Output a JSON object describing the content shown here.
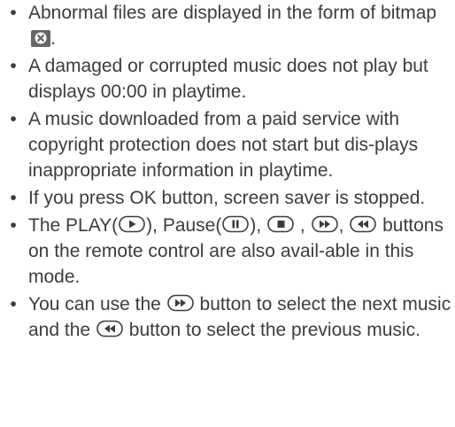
{
  "bullets": [
    {
      "text_before": "Abnormal files are displayed in the form of bitmap",
      "text_after": "."
    },
    {
      "text": "A damaged or corrupted music does not play but displays 00:00 in playtime."
    },
    {
      "text": "A music downloaded from a paid service with copyright protection does not start but dis-plays inappropriate information in playtime."
    },
    {
      "text": "If you press OK button, screen saver is stopped."
    },
    {
      "t1": "The PLAY(",
      "t2": "), Pause(",
      "t3": "),",
      "t4": ",",
      "t5": ",",
      "t6": "buttons on the remote control are also avail-able in this mode."
    },
    {
      "t1": "You can use the",
      "t2": "button to select the next music and the",
      "t3": "button to select the previous music."
    }
  ],
  "icons": {
    "bitmap": "error-bitmap-icon",
    "play": "play-button-icon",
    "pause": "pause-button-icon",
    "stop": "stop-button-icon",
    "forward": "fast-forward-button-icon",
    "rewind": "rewind-button-icon"
  },
  "colors": {
    "text": "#3c3c3c",
    "icon": "#666666"
  }
}
